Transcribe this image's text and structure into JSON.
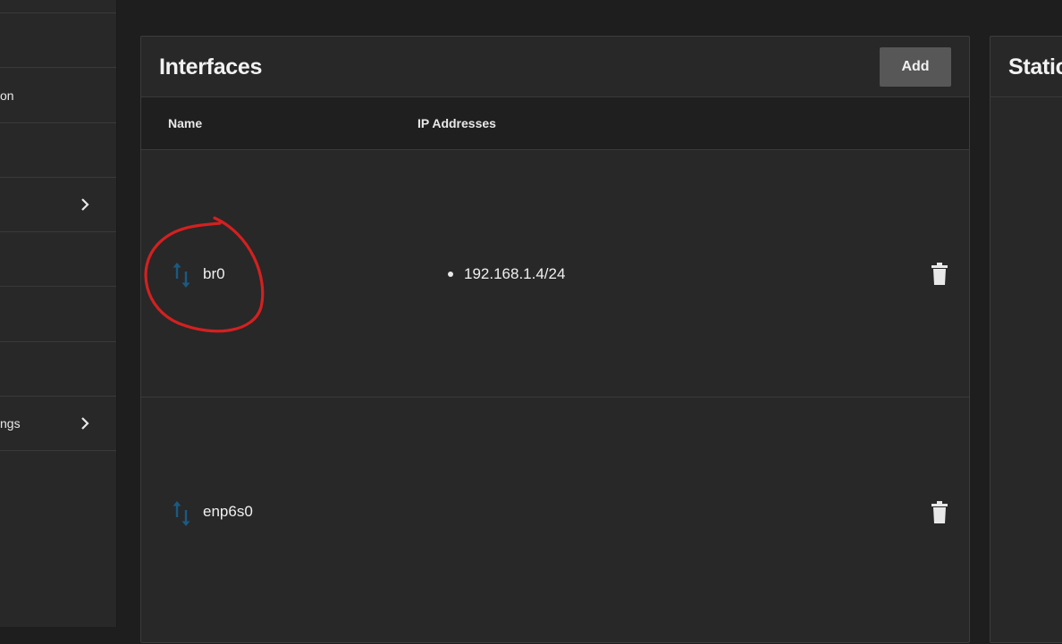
{
  "sidebar": {
    "items": [
      {
        "label": ""
      },
      {
        "label": ""
      },
      {
        "label": "on"
      },
      {
        "label": ""
      },
      {
        "label": "",
        "has_chevron": true
      },
      {
        "label": ""
      },
      {
        "label": ""
      },
      {
        "label": ""
      },
      {
        "label": "ngs",
        "has_chevron": true
      }
    ]
  },
  "interfaces_card": {
    "title": "Interfaces",
    "add_label": "Add",
    "columns": [
      "Name",
      "IP Addresses"
    ],
    "rows": [
      {
        "name": "br0",
        "ip_addresses": [
          "192.168.1.4/24"
        ],
        "icon": "swap-vert-icon",
        "action_icon": "delete-icon"
      },
      {
        "name": "enp6s0",
        "ip_addresses": [],
        "icon": "swap-vert-icon",
        "action_icon": "delete-icon"
      }
    ]
  },
  "static_routes_card": {
    "title": "Static"
  },
  "annotation": {
    "shape": "hand-drawn circle",
    "color": "#d42020",
    "target": "br0"
  },
  "colors": {
    "background": "#1e1e1e",
    "card": "#282828",
    "header": "#1f1f1f",
    "icon_blue": "#1a5a82",
    "button": "#575757"
  }
}
